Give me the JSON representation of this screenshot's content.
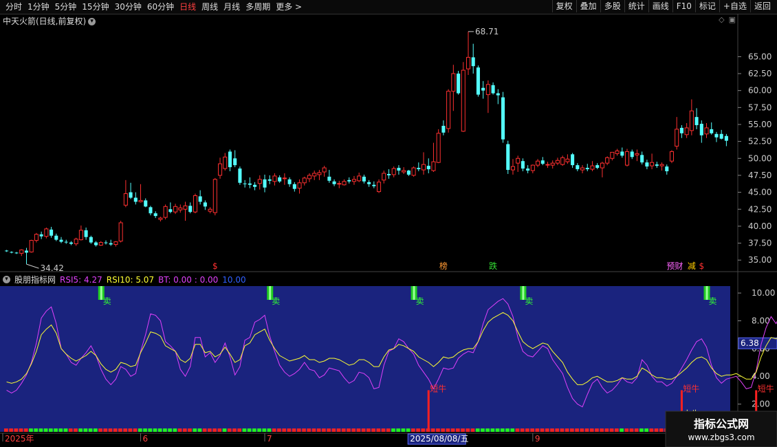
{
  "toolbar": {
    "periods": [
      {
        "label": "分时",
        "active": false
      },
      {
        "label": "1分钟",
        "active": false
      },
      {
        "label": "5分钟",
        "active": false
      },
      {
        "label": "15分钟",
        "active": false
      },
      {
        "label": "30分钟",
        "active": false
      },
      {
        "label": "60分钟",
        "active": false
      },
      {
        "label": "日线",
        "active": true
      },
      {
        "label": "周线",
        "active": false
      },
      {
        "label": "月线",
        "active": false
      },
      {
        "label": "多周期",
        "active": false
      },
      {
        "label": "更多 >",
        "active": false
      }
    ],
    "buttons": [
      "复权",
      "叠加",
      "多股",
      "统计",
      "画线",
      "F10",
      "标记",
      "+自选",
      "返回"
    ]
  },
  "main_chart": {
    "title": "中天火箭(日线,前复权)",
    "high_label": "68.71",
    "low_label": "34.42",
    "y_ticks": [
      "65.00",
      "62.50",
      "60.00",
      "57.50",
      "55.00",
      "52.50",
      "50.00",
      "47.50",
      "45.00",
      "42.50",
      "40.00",
      "37.50",
      "35.00"
    ],
    "markers": [
      {
        "text": "$",
        "color": "#ff3030"
      },
      {
        "text": "榜",
        "color": "#ff9933"
      },
      {
        "text": "跌",
        "color": "#33dd33"
      },
      {
        "text": "减",
        "color": "#ffcc00"
      },
      {
        "text": "预财",
        "color": "#ff66ff"
      },
      {
        "text": "$",
        "color": "#ff3030"
      }
    ]
  },
  "indicator": {
    "name": "股朋指标网",
    "rsi5_label": "RSI5: 4.27",
    "rsi10_label": "RSI10: 5.07",
    "bt_label": "BT: 0.00 : 0.00",
    "extra_label": "10.00",
    "y_ticks": [
      "10.00",
      "8.00",
      "6.00",
      "4.00",
      "2.00"
    ],
    "current_value": "6.38",
    "sell_label": "卖",
    "bull_label": "短牛",
    "big_bull_label": "大牛"
  },
  "x_axis": {
    "labels": [
      "2025年",
      "6",
      "7",
      "8",
      "9",
      "10"
    ],
    "cursor_date": "2025/08/08/五"
  },
  "watermark": {
    "title": "指标公式网",
    "url": "www.zbgs3.com"
  },
  "colors": {
    "up": "#ff3030",
    "down": "#54ffff",
    "rsi5": "#e040fb",
    "rsi10": "#ffff33",
    "panel": "#1a237e"
  },
  "chart_data": {
    "type": "candlestick",
    "ylim": [
      33.5,
      69.5
    ],
    "candles": [
      [
        36.4,
        36.5,
        36.2,
        36.3
      ],
      [
        36.2,
        36.3,
        36.0,
        36.1
      ],
      [
        36.1,
        36.2,
        35.9,
        36.0
      ],
      [
        36.0,
        36.6,
        35.6,
        36.5
      ],
      [
        36.4,
        36.8,
        34.4,
        36.1
      ],
      [
        36.2,
        38.0,
        36.1,
        37.9
      ],
      [
        37.9,
        39.0,
        37.6,
        38.8
      ],
      [
        38.8,
        39.2,
        38.1,
        38.5
      ],
      [
        38.5,
        39.8,
        38.2,
        39.6
      ],
      [
        39.5,
        39.9,
        38.3,
        38.6
      ],
      [
        38.6,
        38.9,
        37.8,
        38.0
      ],
      [
        38.0,
        38.4,
        37.5,
        37.7
      ],
      [
        37.7,
        38.0,
        37.4,
        37.6
      ],
      [
        37.6,
        37.8,
        37.2,
        37.4
      ],
      [
        37.4,
        38.3,
        37.1,
        38.1
      ],
      [
        38.0,
        40.1,
        37.9,
        39.4
      ],
      [
        39.4,
        39.8,
        38.0,
        38.4
      ],
      [
        38.4,
        38.6,
        37.4,
        37.6
      ],
      [
        37.6,
        37.8,
        37.0,
        37.2
      ],
      [
        37.2,
        37.8,
        37.1,
        37.6
      ],
      [
        37.6,
        37.9,
        37.3,
        37.5
      ],
      [
        37.5,
        38.0,
        37.1,
        37.3
      ],
      [
        37.3,
        37.8,
        37.0,
        37.7
      ],
      [
        37.8,
        40.8,
        37.6,
        40.5
      ],
      [
        43.1,
        46.8,
        42.8,
        44.8
      ],
      [
        45.0,
        46.4,
        44.0,
        44.2
      ],
      [
        44.2,
        45.0,
        43.2,
        43.6
      ],
      [
        43.6,
        46.2,
        43.5,
        43.8
      ],
      [
        43.8,
        44.1,
        42.8,
        42.9
      ],
      [
        42.8,
        43.0,
        41.6,
        41.9
      ],
      [
        41.9,
        42.2,
        41.2,
        41.5
      ],
      [
        41.0,
        41.4,
        40.7,
        41.2
      ],
      [
        41.3,
        43.2,
        41.0,
        42.9
      ],
      [
        42.5,
        43.5,
        41.9,
        42.1
      ],
      [
        42.1,
        43.3,
        41.8,
        42.9
      ],
      [
        42.4,
        43.2,
        42.0,
        42.7
      ],
      [
        42.5,
        43.6,
        40.8,
        43.0
      ],
      [
        43.0,
        43.5,
        41.9,
        42.1
      ],
      [
        42.1,
        44.8,
        41.9,
        44.5
      ],
      [
        44.4,
        45.3,
        43.2,
        43.6
      ],
      [
        43.5,
        43.8,
        42.4,
        42.9
      ],
      [
        42.2,
        42.8,
        41.9,
        42.5
      ],
      [
        42.0,
        47.1,
        41.6,
        46.9
      ],
      [
        47.5,
        50.1,
        47.0,
        49.2
      ],
      [
        48.5,
        50.8,
        48.2,
        50.2
      ],
      [
        51.0,
        51.3,
        48.1,
        48.7
      ],
      [
        50.0,
        51.2,
        48.7,
        49.0
      ],
      [
        48.5,
        48.8,
        46.1,
        46.4
      ],
      [
        46.3,
        46.8,
        45.7,
        46.2
      ],
      [
        46.3,
        47.2,
        45.6,
        46.1
      ],
      [
        46.1,
        46.5,
        45.3,
        45.8
      ],
      [
        46.3,
        47.5,
        45.4,
        46.9
      ],
      [
        46.9,
        47.6,
        45.0,
        45.7
      ],
      [
        46.9,
        47.5,
        46.2,
        46.7
      ],
      [
        46.6,
        47.8,
        46.0,
        47.4
      ],
      [
        47.2,
        47.5,
        46.4,
        46.6
      ],
      [
        47.0,
        47.8,
        46.1,
        47.1
      ],
      [
        46.9,
        47.2,
        45.8,
        46.2
      ],
      [
        46.2,
        46.5,
        45.1,
        45.5
      ],
      [
        45.6,
        46.9,
        44.8,
        46.4
      ],
      [
        46.4,
        47.3,
        46.0,
        47.1
      ],
      [
        47.0,
        47.8,
        46.5,
        47.5
      ],
      [
        47.4,
        48.2,
        46.8,
        47.8
      ],
      [
        47.6,
        48.3,
        46.8,
        47.9
      ],
      [
        48.0,
        48.9,
        47.3,
        48.6
      ],
      [
        47.3,
        48.3,
        46.4,
        46.7
      ],
      [
        46.6,
        46.9,
        45.9,
        46.2
      ],
      [
        46.2,
        46.7,
        45.6,
        46.3
      ],
      [
        46.1,
        46.9,
        46.0,
        46.6
      ],
      [
        46.8,
        47.2,
        46.3,
        46.6
      ],
      [
        46.6,
        47.4,
        46.1,
        46.9
      ],
      [
        46.7,
        47.9,
        46.5,
        47.4
      ],
      [
        47.3,
        47.6,
        46.3,
        46.6
      ],
      [
        46.5,
        46.8,
        45.8,
        46.2
      ],
      [
        46.1,
        46.6,
        45.6,
        45.9
      ],
      [
        45.1,
        46.9,
        44.9,
        46.5
      ],
      [
        46.8,
        48.2,
        46.3,
        47.8
      ],
      [
        47.7,
        48.4,
        47.0,
        47.5
      ],
      [
        47.6,
        48.8,
        47.2,
        48.5
      ],
      [
        48.6,
        49.0,
        47.6,
        48.2
      ],
      [
        48.0,
        48.7,
        47.7,
        48.2
      ],
      [
        48.2,
        48.3,
        47.4,
        47.6
      ],
      [
        47.5,
        48.8,
        47.3,
        48.6
      ],
      [
        48.6,
        49.4,
        48.1,
        48.4
      ],
      [
        48.3,
        50.9,
        47.6,
        49.1
      ],
      [
        48.9,
        50.0,
        47.8,
        48.4
      ],
      [
        48.2,
        52.3,
        48.0,
        49.5
      ],
      [
        49.4,
        54.3,
        49.3,
        53.7
      ],
      [
        54.8,
        55.6,
        53.4,
        53.8
      ],
      [
        54.4,
        60.2,
        53.8,
        59.9
      ],
      [
        59.9,
        63.8,
        57.0,
        62.5
      ],
      [
        62.5,
        62.9,
        59.4,
        59.6
      ],
      [
        54.0,
        64.2,
        53.9,
        63.0
      ],
      [
        63.2,
        68.7,
        62.3,
        64.9
      ],
      [
        64.9,
        66.9,
        62.5,
        63.6
      ],
      [
        63.4,
        63.7,
        59.1,
        59.4
      ],
      [
        60.4,
        61.4,
        58.8,
        60.0
      ],
      [
        59.4,
        61.5,
        56.7,
        60.9
      ],
      [
        60.8,
        61.2,
        59.4,
        59.6
      ],
      [
        59.6,
        60.2,
        58.0,
        59.3
      ],
      [
        59.0,
        59.8,
        52.3,
        52.8
      ],
      [
        52.1,
        52.6,
        47.7,
        48.3
      ],
      [
        48.3,
        49.9,
        47.6,
        48.8
      ],
      [
        49.3,
        50.4,
        48.0,
        50.0
      ],
      [
        49.6,
        50.0,
        48.1,
        48.5
      ],
      [
        48.5,
        49.0,
        47.8,
        48.2
      ],
      [
        48.2,
        49.1,
        47.8,
        49.0
      ],
      [
        49.0,
        49.9,
        48.7,
        49.6
      ],
      [
        49.7,
        50.2,
        49.0,
        49.2
      ],
      [
        49.0,
        49.5,
        48.6,
        49.1
      ],
      [
        49.0,
        49.7,
        48.5,
        49.3
      ],
      [
        49.3,
        50.1,
        49.0,
        49.7
      ],
      [
        49.1,
        50.4,
        48.9,
        50.1
      ],
      [
        49.5,
        50.6,
        49.2,
        49.9
      ],
      [
        50.6,
        50.8,
        48.6,
        49.0
      ],
      [
        49.0,
        49.3,
        48.1,
        48.4
      ],
      [
        48.3,
        49.0,
        47.8,
        48.6
      ],
      [
        48.6,
        49.2,
        48.1,
        48.4
      ],
      [
        48.4,
        49.6,
        48.1,
        48.9
      ],
      [
        49.0,
        49.3,
        48.4,
        48.6
      ],
      [
        48.6,
        49.5,
        47.2,
        49.3
      ],
      [
        49.3,
        50.3,
        49.0,
        50.1
      ],
      [
        50.0,
        50.6,
        49.7,
        50.9
      ],
      [
        50.7,
        51.4,
        50.4,
        51.1
      ],
      [
        51.0,
        51.6,
        50.1,
        50.4
      ],
      [
        49.0,
        51.4,
        48.8,
        51.0
      ],
      [
        51.0,
        51.3,
        49.9,
        50.2
      ],
      [
        50.5,
        51.3,
        49.6,
        50.7
      ],
      [
        50.5,
        51.0,
        49.1,
        49.4
      ],
      [
        49.4,
        49.8,
        48.4,
        48.8
      ],
      [
        48.9,
        50.7,
        48.4,
        49.4
      ],
      [
        49.1,
        49.5,
        48.6,
        48.9
      ],
      [
        48.9,
        49.4,
        48.2,
        49.1
      ],
      [
        48.8,
        49.1,
        47.6,
        48.1
      ],
      [
        49.6,
        51.2,
        49.3,
        51.0
      ],
      [
        51.8,
        56.1,
        51.3,
        54.3
      ],
      [
        54.5,
        54.9,
        53.0,
        53.7
      ],
      [
        53.5,
        55.2,
        53.0,
        54.5
      ],
      [
        54.1,
        58.7,
        53.4,
        57.0
      ],
      [
        56.1,
        57.4,
        54.3,
        54.9
      ],
      [
        55.1,
        55.6,
        52.3,
        53.4
      ],
      [
        53.6,
        55.2,
        53.0,
        54.5
      ],
      [
        54.3,
        55.3,
        53.5,
        53.7
      ],
      [
        53.6,
        53.9,
        52.4,
        53.1
      ],
      [
        53.6,
        54.2,
        52.8,
        52.9
      ],
      [
        53.3,
        53.6,
        51.8,
        52.6
      ]
    ],
    "rsi5": [
      3.0,
      2.8,
      3.0,
      3.5,
      4.1,
      5.0,
      6.4,
      8.2,
      8.7,
      9.0,
      7.8,
      6.0,
      5.6,
      5.0,
      4.8,
      5.3,
      5.7,
      6.2,
      5.5,
      4.5,
      3.8,
      3.4,
      3.8,
      4.7,
      4.5,
      4.0,
      4.2,
      5.8,
      7.0,
      8.5,
      8.4,
      8.0,
      6.5,
      6.2,
      5.8,
      4.5,
      4.0,
      4.7,
      6.8,
      6.8,
      5.4,
      5.7,
      5.0,
      5.5,
      6.4,
      5.4,
      4.1,
      4.7,
      6.6,
      6.8,
      7.9,
      8.1,
      8.4,
      6.9,
      5.8,
      4.8,
      4.3,
      4.0,
      4.2,
      4.5,
      5.0,
      4.5,
      4.4,
      3.9,
      4.1,
      4.6,
      4.5,
      4.4,
      3.9,
      3.5,
      3.7,
      4.3,
      4.2,
      3.9,
      3.1,
      3.2,
      4.8,
      5.8,
      6.0,
      6.7,
      6.5,
      6.0,
      5.6,
      4.8,
      4.3,
      3.8,
      3.1,
      3.8,
      4.6,
      4.5,
      4.6,
      5.3,
      5.6,
      5.8,
      5.7,
      6.5,
      7.8,
      8.8,
      9.1,
      9.4,
      9.6,
      9.2,
      8.3,
      6.8,
      5.8,
      5.5,
      5.4,
      5.8,
      6.2,
      6.0,
      5.2,
      4.7,
      4.2,
      3.2,
      2.4,
      2.0,
      1.8,
      2.7,
      3.5,
      3.8,
      3.2,
      2.8,
      3.0,
      3.4,
      3.9,
      3.6,
      3.5,
      3.9,
      5.2,
      4.8,
      4.0,
      3.6,
      3.6,
      3.3,
      3.5,
      4.0,
      4.6,
      5.2,
      5.9,
      6.5,
      6.7,
      6.1,
      4.8,
      3.9,
      3.5,
      3.8,
      3.9,
      4.0,
      3.6,
      3.1,
      3.2,
      4.4,
      6.3,
      7.5,
      8.3,
      7.8,
      8.5,
      8.0,
      6.8,
      5.8,
      5.3,
      5.7,
      5.3,
      4.8,
      4.4
    ],
    "rsi10": [
      3.6,
      3.5,
      3.6,
      3.8,
      4.2,
      4.9,
      5.8,
      7.0,
      7.4,
      7.7,
      7.1,
      6.0,
      5.6,
      5.3,
      5.1,
      5.3,
      5.5,
      5.8,
      5.5,
      4.9,
      4.5,
      4.3,
      4.5,
      5.0,
      4.9,
      4.7,
      4.8,
      5.7,
      6.4,
      7.2,
      7.1,
      6.9,
      6.2,
      6.0,
      5.8,
      5.2,
      5.0,
      5.3,
      6.3,
      6.3,
      5.7,
      5.8,
      5.4,
      5.6,
      6.1,
      5.6,
      5.0,
      5.2,
      6.2,
      6.4,
      7.0,
      7.2,
      7.4,
      6.6,
      6.0,
      5.5,
      5.3,
      5.1,
      5.2,
      5.3,
      5.5,
      5.2,
      5.2,
      5.0,
      5.1,
      5.3,
      5.3,
      5.2,
      5.0,
      4.8,
      4.9,
      5.2,
      5.2,
      5.0,
      4.7,
      4.7,
      5.4,
      5.9,
      6.0,
      6.3,
      6.2,
      6.0,
      5.8,
      5.4,
      5.2,
      5.0,
      4.7,
      5.0,
      5.4,
      5.3,
      5.4,
      5.7,
      5.9,
      6.0,
      6.0,
      6.5,
      7.3,
      7.9,
      8.2,
      8.4,
      8.6,
      8.4,
      8.0,
      7.2,
      6.5,
      6.2,
      6.0,
      6.2,
      6.4,
      6.3,
      5.8,
      5.4,
      5.0,
      4.3,
      3.8,
      3.4,
      3.4,
      3.6,
      3.9,
      4.0,
      3.8,
      3.6,
      3.6,
      3.7,
      3.9,
      3.8,
      3.8,
      4.0,
      4.6,
      4.4,
      4.1,
      3.9,
      3.9,
      3.8,
      3.8,
      4.0,
      4.3,
      4.6,
      5.0,
      5.3,
      5.4,
      5.2,
      4.6,
      4.2,
      4.0,
      4.1,
      4.1,
      4.2,
      4.0,
      3.8,
      3.8,
      4.3,
      5.4,
      6.2,
      6.8,
      6.7,
      7.0,
      6.9,
      6.3,
      5.8,
      5.5,
      5.8,
      5.5,
      5.3,
      5.1
    ],
    "sell_signals": [
      19,
      53,
      82,
      104,
      141
    ],
    "short_bull_signals": [
      85,
      136,
      151
    ],
    "big_bull_signals": [
      136,
      151
    ],
    "indicator_ylim": [
      0,
      10.5
    ]
  }
}
